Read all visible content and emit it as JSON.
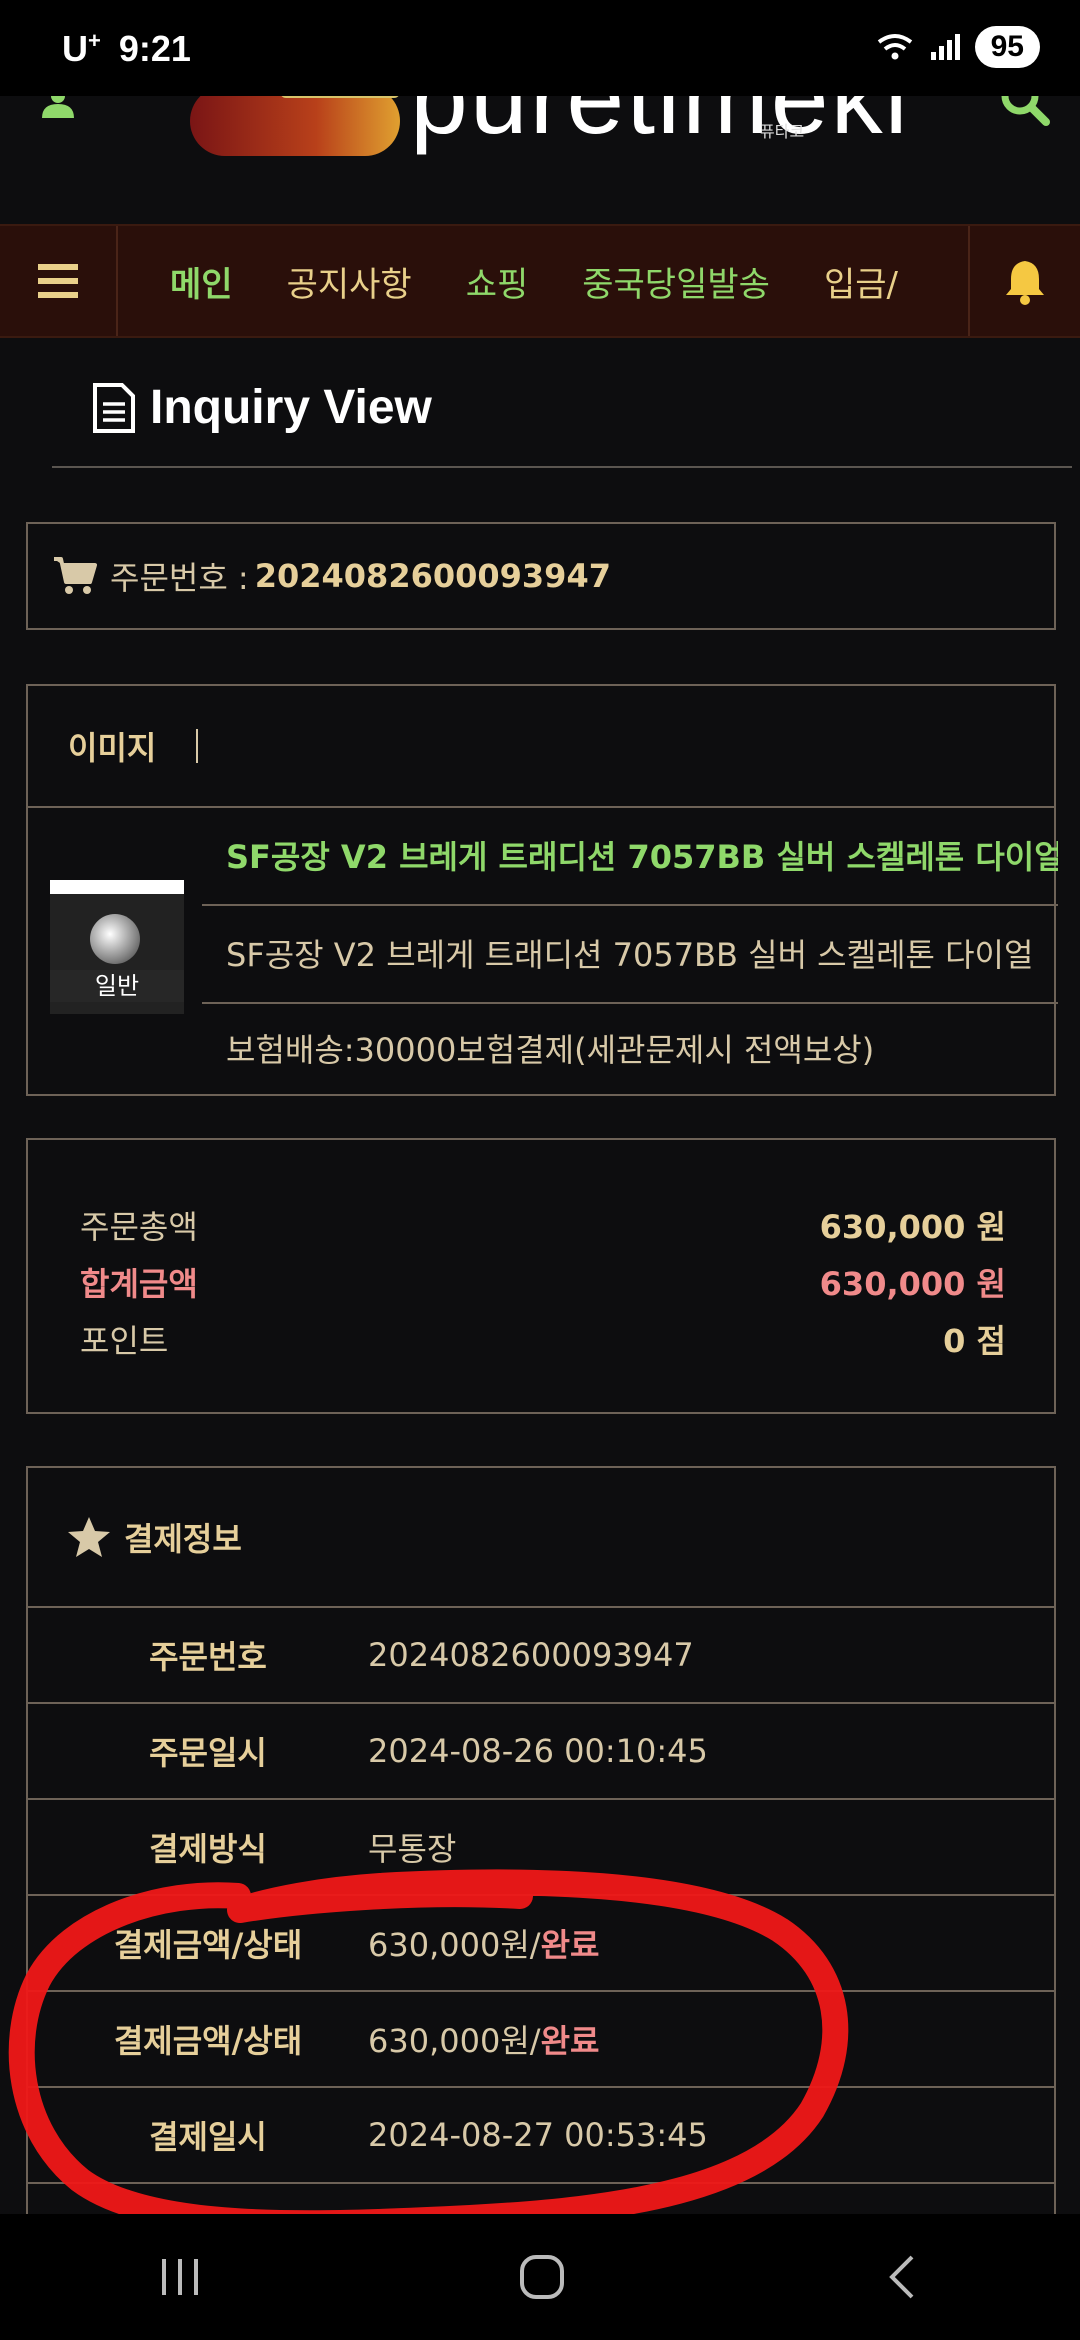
{
  "status_bar": {
    "carrier": "U",
    "carrier_sup": "+",
    "time": "9:21",
    "battery": "95"
  },
  "header": {
    "logo_text": "puretimeki",
    "logo_sub": "퓨타코"
  },
  "nav": {
    "items": [
      {
        "label": "메인"
      },
      {
        "label": "공지사항"
      },
      {
        "label": "쇼핑"
      },
      {
        "label": "중국당일발송"
      },
      {
        "label": "입금/"
      }
    ]
  },
  "page": {
    "title": "Inquiry View"
  },
  "order": {
    "label": "주문번호 :",
    "number": "2024082600093947"
  },
  "product_box": {
    "header_label": "이미지",
    "thumb_label": "일반",
    "name_link": "SF공장 V2 브레게 트래디션 7057BB 실버 스켈레톤 다이얼",
    "name": "SF공장 V2 브레게 트래디션 7057BB 실버 스켈레톤 다이얼",
    "option": "보험배송:30000보험결제(세관문제시 전액보상)"
  },
  "summary": {
    "rows": [
      {
        "label": "주문총액",
        "value": "630,000 원"
      },
      {
        "label": "합계금액",
        "value": "630,000 원"
      },
      {
        "label": "포인트",
        "value": "0 점"
      }
    ]
  },
  "payment": {
    "title": "결제정보",
    "rows": [
      {
        "key": "주문번호",
        "value": "2024082600093947"
      },
      {
        "key": "주문일시",
        "value": "2024-08-26 00:10:45"
      },
      {
        "key": "결제방식",
        "value": "무통장"
      },
      {
        "key": "결제금액/상태",
        "value": "630,000원/",
        "status": "완료"
      },
      {
        "key": "결제금액/상태",
        "value": "630,000원/",
        "status": "완료"
      },
      {
        "key": "결제일시",
        "value": "2024-08-27 00:53:45"
      }
    ]
  },
  "colors": {
    "accent_gold": "#e6cf9a",
    "accent_green": "#8fd86a",
    "accent_red": "#f08a8a",
    "nav_bg": "#2a0f0a"
  }
}
